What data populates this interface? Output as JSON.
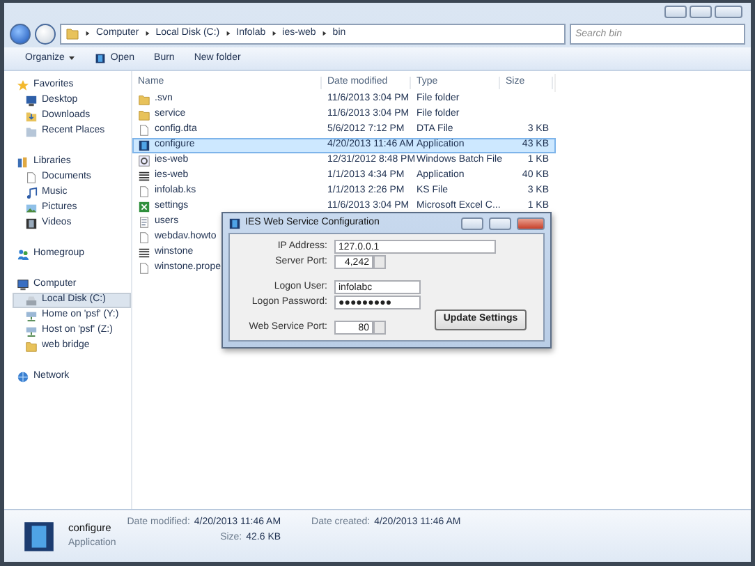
{
  "address_bar": {
    "path": [
      "Computer",
      "Local Disk (C:)",
      "Infolab",
      "ies-web",
      "bin"
    ]
  },
  "search": {
    "placeholder": "Search bin"
  },
  "toolbar": {
    "buttons": [
      {
        "label": "Organize",
        "kind": "menu"
      },
      {
        "label": "Open",
        "kind": "open"
      },
      {
        "label": "Burn",
        "kind": "plain"
      },
      {
        "label": "New folder",
        "kind": "plain"
      }
    ]
  },
  "sidebar": {
    "groups": [
      {
        "label": "Favorites",
        "kind": "star",
        "children": [
          {
            "label": "Desktop",
            "kind": "desktop",
            "selected": false
          },
          {
            "label": "Downloads",
            "kind": "download",
            "selected": false
          },
          {
            "label": "Recent Places",
            "kind": "recent",
            "selected": false
          }
        ]
      },
      {
        "label": "Libraries",
        "kind": "library",
        "children": [
          {
            "label": "Documents",
            "kind": "document",
            "selected": false
          },
          {
            "label": "Music",
            "kind": "music",
            "selected": false
          },
          {
            "label": "Pictures",
            "kind": "picture",
            "selected": false
          },
          {
            "label": "Videos",
            "kind": "video",
            "selected": false
          }
        ]
      },
      {
        "label": "Homegroup",
        "kind": "homegroup"
      },
      {
        "label": "Computer",
        "kind": "computer",
        "children": [
          {
            "label": "Local Disk (C:)",
            "kind": "drive",
            "selected": true
          },
          {
            "label": "Home on 'psf' (Y:)",
            "kind": "netdrive",
            "selected": false
          },
          {
            "label": "Host on 'psf' (Z:)",
            "kind": "netdrive",
            "selected": false
          },
          {
            "label": "web bridge",
            "kind": "folder",
            "selected": false
          }
        ]
      },
      {
        "label": "Network",
        "kind": "network"
      }
    ]
  },
  "table": {
    "columns": [
      "Name",
      "Date modified",
      "Type",
      "Size"
    ],
    "rows": [
      {
        "name": ".svn",
        "date": "11/6/2013 3:04 PM",
        "type": "File folder",
        "kind": "folder",
        "selected": false
      },
      {
        "name": "service",
        "date": "11/6/2013 3:04 PM",
        "type": "File folder",
        "kind": "folder",
        "selected": false
      },
      {
        "name": "config.dta",
        "date": "5/6/2012 7:12 PM",
        "type": "DTA File",
        "size": "3 KB",
        "kind": "file",
        "selected": false
      },
      {
        "name": "configure",
        "date": "4/20/2013 11:46 AM",
        "type": "Application",
        "size": "43 KB",
        "kind": "app",
        "selected": true
      },
      {
        "name": "ies-web",
        "date": "12/31/2012 8:48 PM",
        "type": "Windows Batch File",
        "size": "1 KB",
        "kind": "batch",
        "selected": false
      },
      {
        "name": "ies-web",
        "date": "1/1/2013 4:34 PM",
        "type": "Application",
        "size": "40 KB",
        "kind": "exe",
        "selected": false
      },
      {
        "name": "infolab.ks",
        "date": "1/1/2013 2:26 PM",
        "type": "KS File",
        "size": "3 KB",
        "kind": "file",
        "selected": false
      },
      {
        "name": "settings",
        "date": "11/6/2013 3:04 PM",
        "type": "Microsoft Excel C...",
        "size": "1 KB",
        "kind": "sheet",
        "selected": false
      },
      {
        "name": "users",
        "kind": "text",
        "selected": false
      },
      {
        "name": "webdav.howto",
        "kind": "file",
        "selected": false
      },
      {
        "name": "winstone",
        "kind": "exe",
        "selected": false
      },
      {
        "name": "winstone.prope",
        "kind": "file",
        "selected": false
      }
    ]
  },
  "dialog": {
    "title": "IES Web Service Configuration",
    "fields": [
      {
        "label": "IP Address:",
        "value": "127.0.0.1",
        "kind": "address"
      },
      {
        "label": "Server Port:",
        "value": "4,242",
        "kind": "spinner"
      },
      {
        "label": "Logon User:",
        "value": "infolabc",
        "kind": "text"
      },
      {
        "label": "Logon Password:",
        "value": "●●●●●●●●●",
        "kind": "text"
      },
      {
        "label": "Web Service Port:",
        "value": "80",
        "kind": "spinner"
      }
    ],
    "button": "Update Settings"
  },
  "details": {
    "name": "configure",
    "type": "Application",
    "columns": [
      [
        {
          "label": "Date modified:",
          "value": "4/20/2013 11:46 AM"
        },
        {
          "label": "Size:",
          "value": "42.6 KB"
        }
      ],
      [
        {
          "label": "Date created:",
          "value": "4/20/2013 11:46 AM"
        }
      ]
    ]
  }
}
